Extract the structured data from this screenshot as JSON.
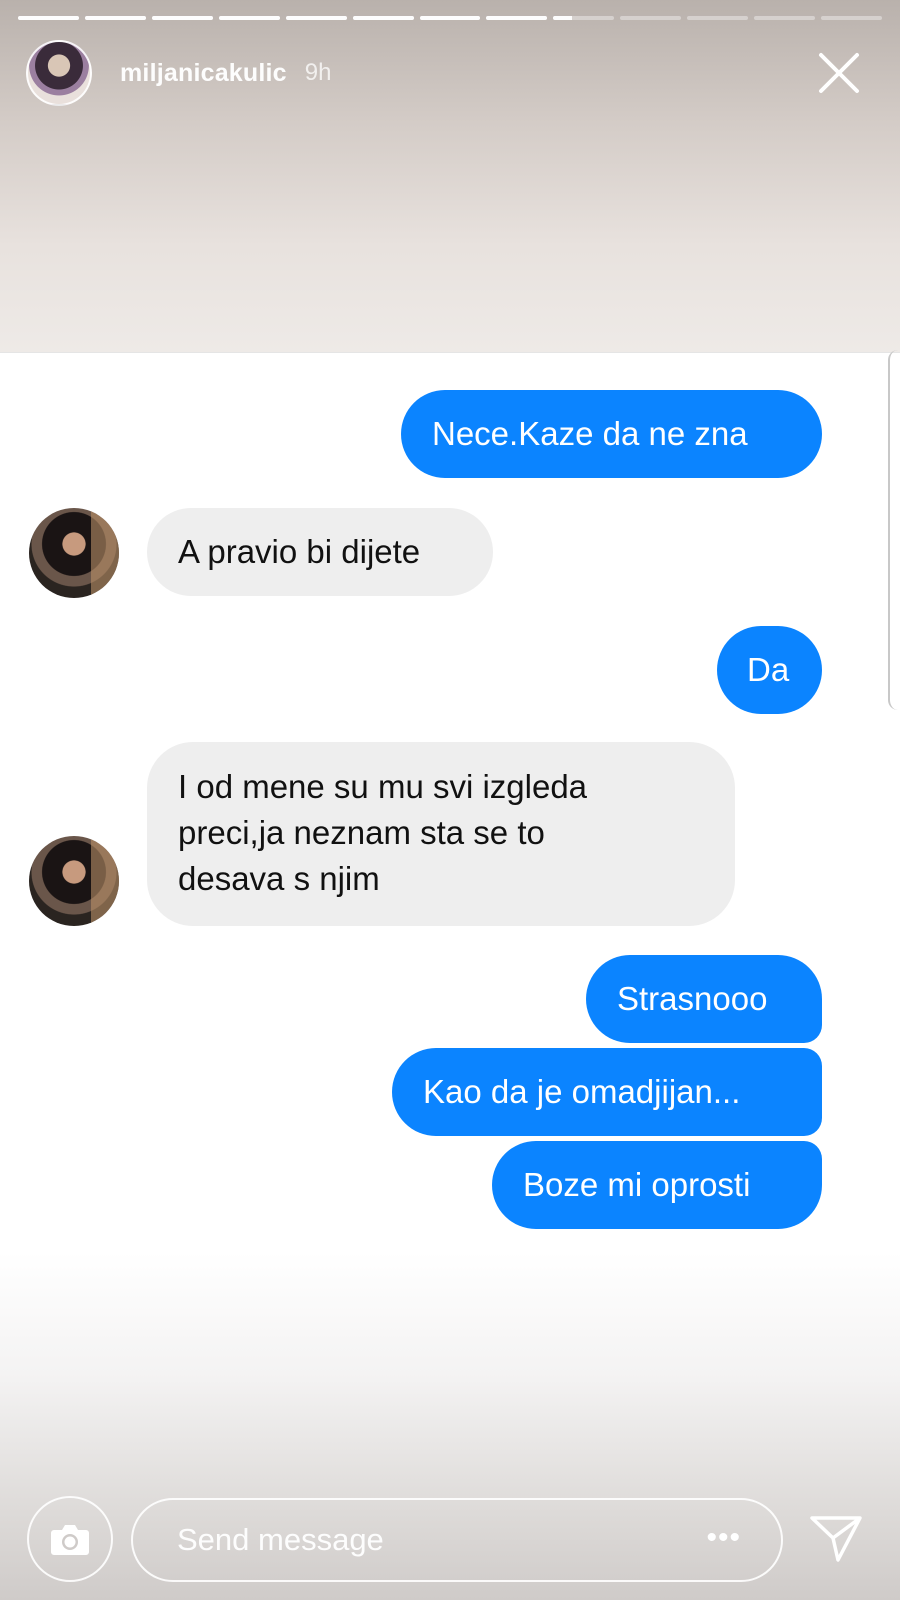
{
  "story": {
    "username": "miljanicakulic",
    "time": "9h",
    "progress_segments": 13,
    "active_segment_index": 8,
    "active_segment_fill": 0.3
  },
  "chat": {
    "messages": [
      {
        "side": "out",
        "text": "Nece.Kaze da ne zna"
      },
      {
        "side": "in",
        "text": "A pravio bi dijete"
      },
      {
        "side": "out",
        "text": "Da"
      },
      {
        "side": "in",
        "text": "I od mene su mu svi izgleda\npreci,ja neznam sta se to\ndesava s njim"
      },
      {
        "side": "out",
        "text": "Strasnooo"
      },
      {
        "side": "out",
        "text": "Kao da je omadjijan..."
      },
      {
        "side": "out",
        "text": "Boze mi oprosti"
      }
    ]
  },
  "composer": {
    "placeholder": "Send message",
    "more_label": "•••",
    "icons": [
      "camera-icon",
      "more-icon",
      "send-icon"
    ]
  },
  "colors": {
    "outgoing_bubble": "#0b84ff",
    "incoming_bubble": "#eeeeee"
  }
}
